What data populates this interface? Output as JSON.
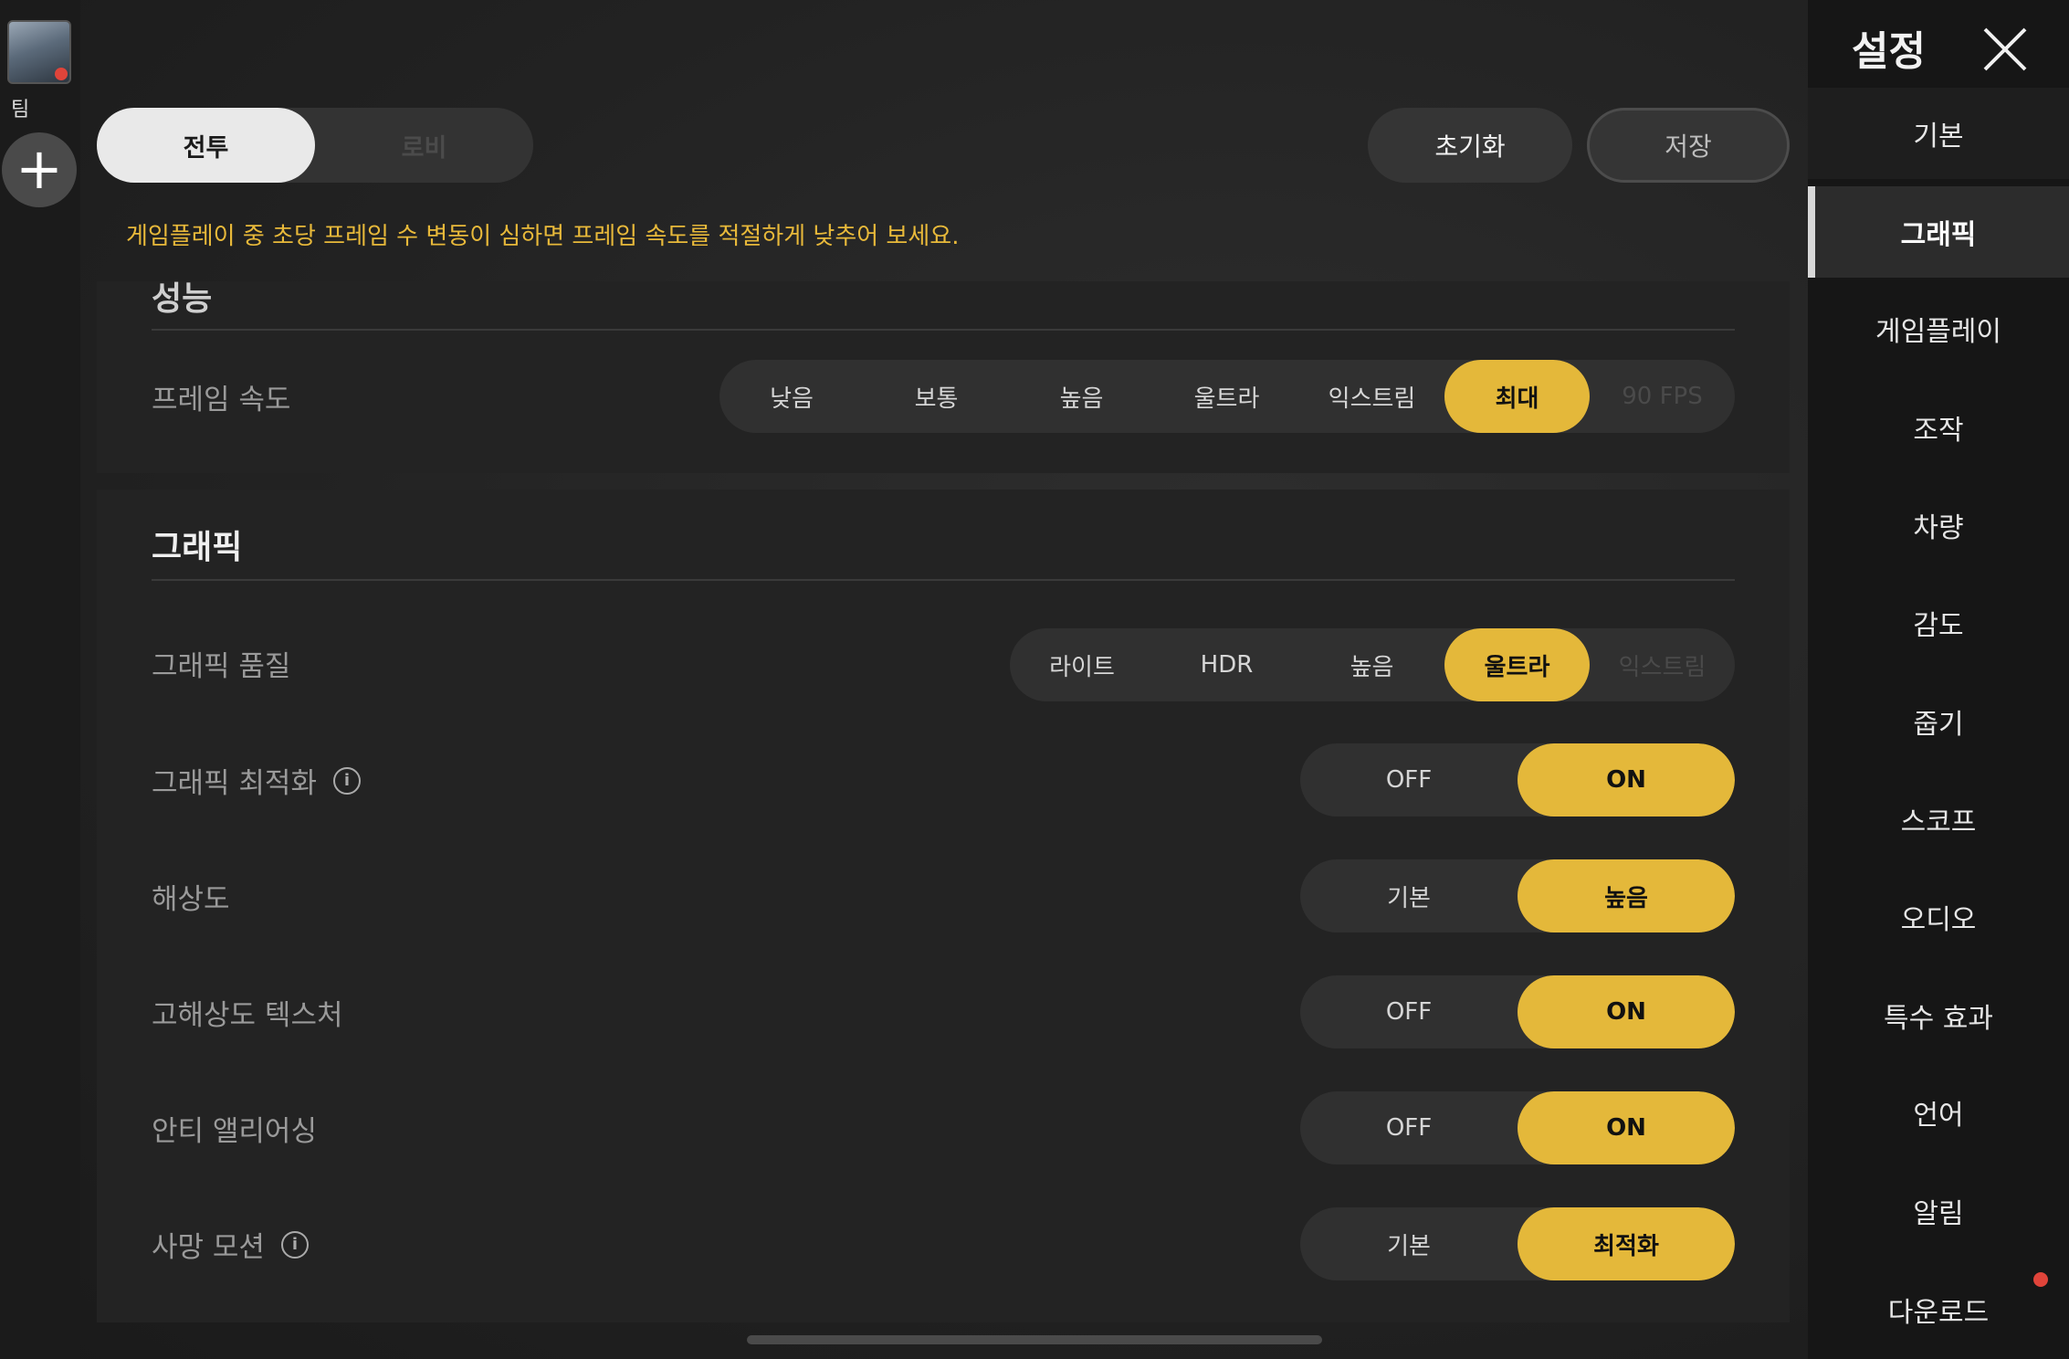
{
  "sidebar_left": {
    "team_label": "팀",
    "add_label": "+"
  },
  "mode_tabs": {
    "battle": "전투",
    "lobby": "로비"
  },
  "actions": {
    "reset": "초기화",
    "save": "저장"
  },
  "notice": "게임플레이 중 초당 프레임 수 변동이 심하면 프레임 속도를 적절하게 낮추어 보세요.",
  "performance": {
    "title": "성능",
    "frame_rate": {
      "label": "프레임 속도",
      "options": [
        "낮음",
        "보통",
        "높음",
        "울트라",
        "익스트림",
        "최대",
        "90 FPS"
      ],
      "selected": "최대"
    }
  },
  "graphics": {
    "title": "그래픽",
    "quality": {
      "label": "그래픽 품질",
      "options": [
        "라이트",
        "HDR",
        "높음",
        "울트라",
        "익스트림"
      ],
      "selected": "울트라"
    },
    "optimization": {
      "label": "그래픽 최적화",
      "options": [
        "OFF",
        "ON"
      ],
      "selected": "ON"
    },
    "resolution": {
      "label": "해상도",
      "options": [
        "기본",
        "높음"
      ],
      "selected": "높음"
    },
    "hd_texture": {
      "label": "고해상도 텍스처",
      "options": [
        "OFF",
        "ON"
      ],
      "selected": "ON"
    },
    "anti_alias": {
      "label": "안티 앨리어싱",
      "options": [
        "OFF",
        "ON"
      ],
      "selected": "ON"
    },
    "death_motion": {
      "label": "사망 모션",
      "options": [
        "기본",
        "최적화"
      ],
      "selected": "최적화"
    }
  },
  "sidebar": {
    "title": "설정",
    "items": [
      "기본",
      "그래픽",
      "게임플레이",
      "조작",
      "차량",
      "감도",
      "줍기",
      "스코프",
      "오디오",
      "특수 효과",
      "언어",
      "알림",
      "다운로드"
    ],
    "active": "그래픽"
  },
  "colors": {
    "accent": "#e4b83a",
    "notice": "#e8b93a"
  }
}
